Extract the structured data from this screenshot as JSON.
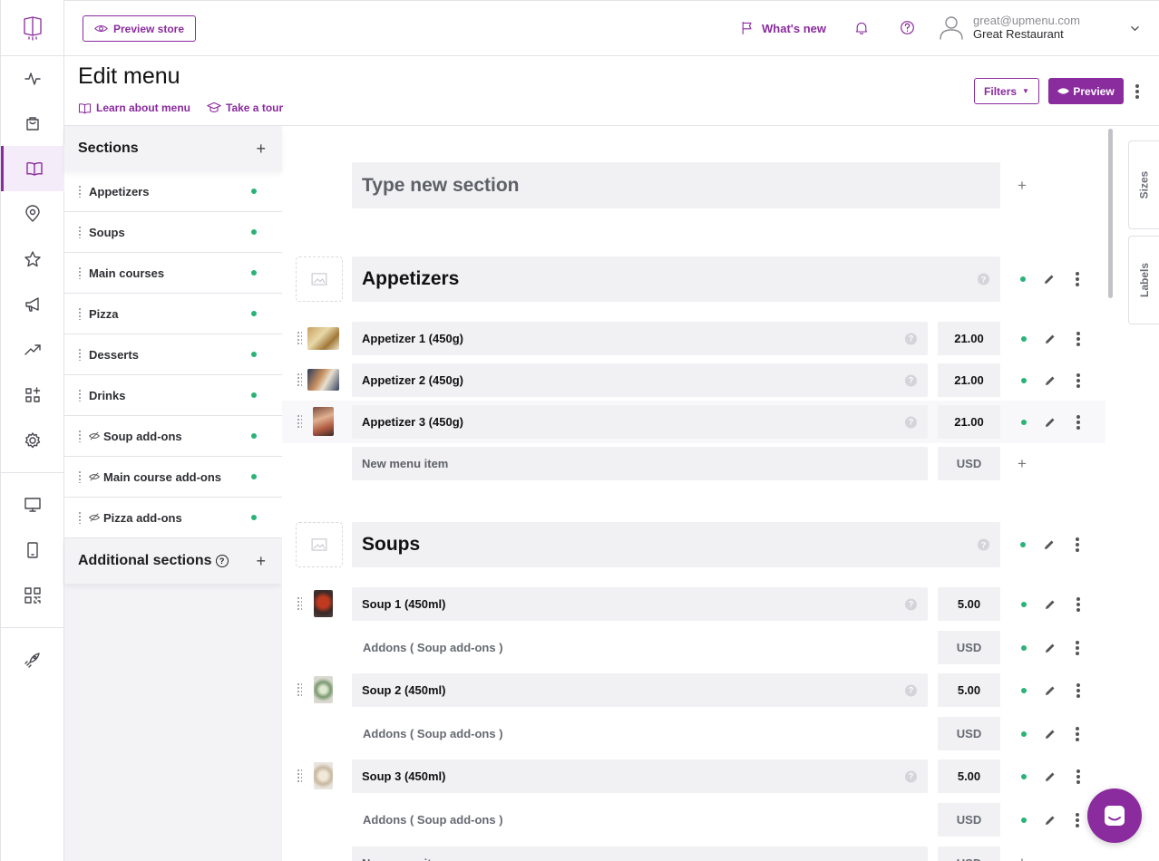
{
  "topbar": {
    "preview_store": "Preview store",
    "whats_new": "What's new",
    "user_email": "great@upmenu.com",
    "user_name": "Great Restaurant"
  },
  "page": {
    "title": "Edit menu",
    "learn_link": "Learn about menu",
    "tour_link": "Take a tour",
    "filters": "Filters",
    "preview": "Preview"
  },
  "sections_panel": {
    "title": "Sections",
    "items": [
      {
        "label": "Appetizers",
        "hidden": false
      },
      {
        "label": "Soups",
        "hidden": false
      },
      {
        "label": "Main courses",
        "hidden": false
      },
      {
        "label": "Pizza",
        "hidden": false
      },
      {
        "label": "Desserts",
        "hidden": false
      },
      {
        "label": "Drinks",
        "hidden": false
      },
      {
        "label": "Soup add-ons",
        "hidden": true
      },
      {
        "label": "Main course add-ons",
        "hidden": true
      },
      {
        "label": "Pizza add-ons",
        "hidden": true
      }
    ],
    "additional_title": "Additional sections"
  },
  "main": {
    "new_section_placeholder": "Type new section",
    "sections": [
      {
        "name": "Appetizers",
        "items": [
          {
            "name": "Appetizer 1 (450g)",
            "price": "21.00"
          },
          {
            "name": "Appetizer 2 (450g)",
            "price": "21.00"
          },
          {
            "name": "Appetizer 3 (450g)",
            "price": "21.00"
          }
        ],
        "new_item_placeholder": "New menu item",
        "currency": "USD"
      },
      {
        "name": "Soups",
        "items": [
          {
            "name": "Soup 1 (450ml)",
            "price": "5.00",
            "addon": "Addons ( Soup add-ons )",
            "addon_price": "USD"
          },
          {
            "name": "Soup 2 (450ml)",
            "price": "5.00",
            "addon": "Addons ( Soup add-ons )",
            "addon_price": "USD"
          },
          {
            "name": "Soup 3 (450ml)",
            "price": "5.00",
            "addon": "Addons ( Soup add-ons )",
            "addon_price": "USD"
          }
        ],
        "new_item_placeholder": "New menu item",
        "currency": "USD"
      }
    ]
  },
  "right_tabs": {
    "sizes": "Sizes",
    "labels": "Labels"
  },
  "colors": {
    "brand": "#8a2b9e",
    "status_active": "#2ab377"
  }
}
